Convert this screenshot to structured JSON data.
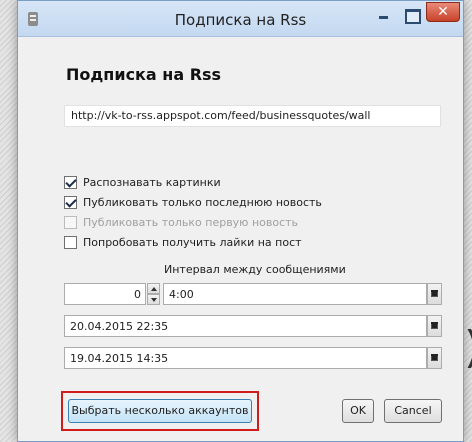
{
  "window": {
    "title": "Подписка на Rss"
  },
  "heading": "Подписка на Rss",
  "feed_url": "http://vk-to-rss.appspot.com/feed/businessquotes/wall",
  "options": [
    {
      "label": "Распознавать картинки",
      "checked": true,
      "enabled": true
    },
    {
      "label": "Публиковать только последнюю новость",
      "checked": true,
      "enabled": true
    },
    {
      "label": "Публиковать только первую новость",
      "checked": false,
      "enabled": false
    },
    {
      "label": "Попробовать получить лайки на пост",
      "checked": false,
      "enabled": true
    }
  ],
  "interval": {
    "label": "Интервал между сообщениями",
    "count": "0",
    "time": "4:00"
  },
  "date_from": "20.04.2015 22:35",
  "date_to": "19.04.2015 14:35",
  "buttons": {
    "accounts": "Выбрать несколько аккаунтов",
    "ok": "OK",
    "cancel": "Cancel"
  },
  "colors": {
    "highlight": "#d21c1c",
    "titlebar": "#c3d8f0",
    "close_button": "#c7422a"
  },
  "icons": [
    "app-icon",
    "minimize-icon",
    "maximize-icon",
    "close-icon",
    "spin-up-icon",
    "spin-down-icon",
    "calendar-icon"
  ],
  "background": {
    "text": ")"
  }
}
